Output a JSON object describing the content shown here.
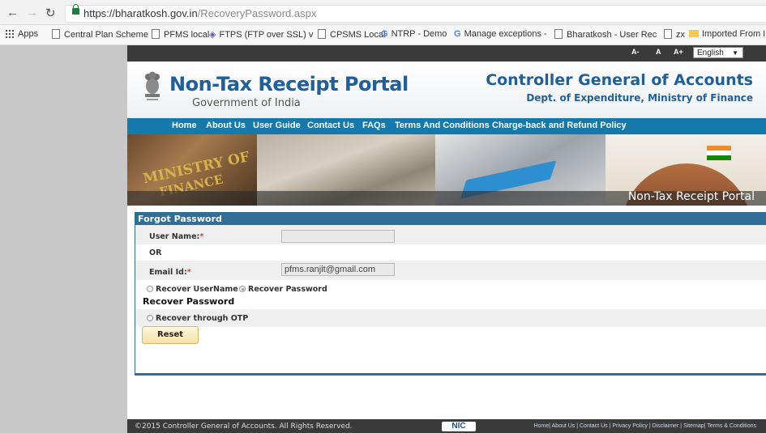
{
  "browser": {
    "url_host": "https://bharatkosh.gov.in",
    "url_path": "/RecoveryPassword.aspx",
    "bookmarks": [
      {
        "label": "Apps",
        "icon": "apps-icon"
      },
      {
        "label": "Central Plan Scheme",
        "icon": "page-icon"
      },
      {
        "label": "PFMS local",
        "icon": "page-icon"
      },
      {
        "label": "FTPS (FTP over SSL) v",
        "icon": "diamond-icon"
      },
      {
        "label": "CPSMS Local",
        "icon": "page-icon"
      },
      {
        "label": "NTRP - Demo",
        "icon": "google-icon"
      },
      {
        "label": "Manage exceptions -",
        "icon": "google-icon"
      },
      {
        "label": "Bharatkosh - User Rec",
        "icon": "page-icon"
      },
      {
        "label": "zx",
        "icon": "page-icon"
      },
      {
        "label": "Imported From IE",
        "icon": "folder-icon"
      }
    ]
  },
  "topbar": {
    "font_small": "A-",
    "font_normal": "A",
    "font_large": "A+",
    "language": "English"
  },
  "header": {
    "title": "Non-Tax Receipt Portal",
    "subtitle": "Government of India",
    "org_title": "Controller General of Accounts",
    "org_subtitle": "Dept. of Expenditure, Ministry of Finance"
  },
  "menu": [
    "Home",
    "About Us",
    "User Guide",
    "Contact Us",
    "FAQs",
    "Terms And Conditions",
    "Charge-back and Refund Policy"
  ],
  "banner": {
    "caption": "Non-Tax Receipt Portal",
    "ministry_sign_line1": "MINISTRY OF",
    "ministry_sign_line2": "FINANCE"
  },
  "form": {
    "title": "Forgot Password",
    "username_label": "User Name:",
    "username_value": "",
    "or_label": "OR",
    "email_label": "Email Id:",
    "email_value": "pfms.ranjit@gmail.com",
    "required_mark": "*",
    "option_recover_username": "Recover UserName",
    "option_recover_password": "Recover Password",
    "selected_option": "Recover Password",
    "section_heading": "Recover Password",
    "otp_option": "Recover through OTP",
    "reset_button": "Reset"
  },
  "footer": {
    "copyright": "©2015 Controller General of Accounts. All Rights Reserved.",
    "logo_text": "NIC",
    "links": "Home| About Us | Contact Us | Privacy Policy | Disclaimer | Sitemap| Terms & Conditions"
  },
  "colors": {
    "menu_bar": "#1679ab",
    "title_blue": "#1f5f9a",
    "panel_header": "#2f6f97",
    "page_gray": "#c8c8c8"
  }
}
